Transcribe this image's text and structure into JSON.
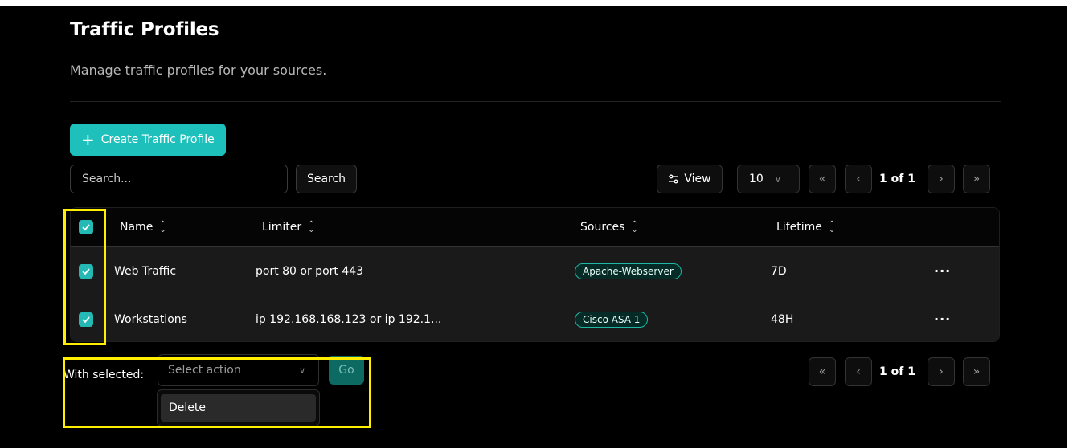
{
  "header": {
    "title": "Traffic Profiles",
    "subtitle": "Manage traffic profiles for your sources."
  },
  "toolbar": {
    "create_label": "Create Traffic Profile",
    "search_placeholder": "Search...",
    "search_label": "Search",
    "view_label": "View",
    "page_size": "10"
  },
  "pagination": {
    "first": "«",
    "prev": "‹",
    "page_text": "1 of 1",
    "next": "›",
    "last": "»"
  },
  "table": {
    "columns": [
      "Name",
      "Limiter",
      "Sources",
      "Lifetime"
    ],
    "rows": [
      {
        "name": "Web Traffic",
        "limiter": "port 80 or port 443",
        "source": "Apache-Webserver",
        "lifetime": "7D",
        "selected": true
      },
      {
        "name": "Workstations",
        "limiter": "ip 192.168.168.123 or ip 192.1...",
        "source": "Cisco ASA 1",
        "lifetime": "48H",
        "selected": true
      }
    ],
    "row_menu_label": "···"
  },
  "bulk": {
    "label": "With selected:",
    "select_placeholder": "Select action",
    "go_label": "Go",
    "options": [
      "Delete"
    ]
  },
  "colors": {
    "accent": "#1ec0bc",
    "highlight": "#ffee00",
    "background": "#000000"
  }
}
